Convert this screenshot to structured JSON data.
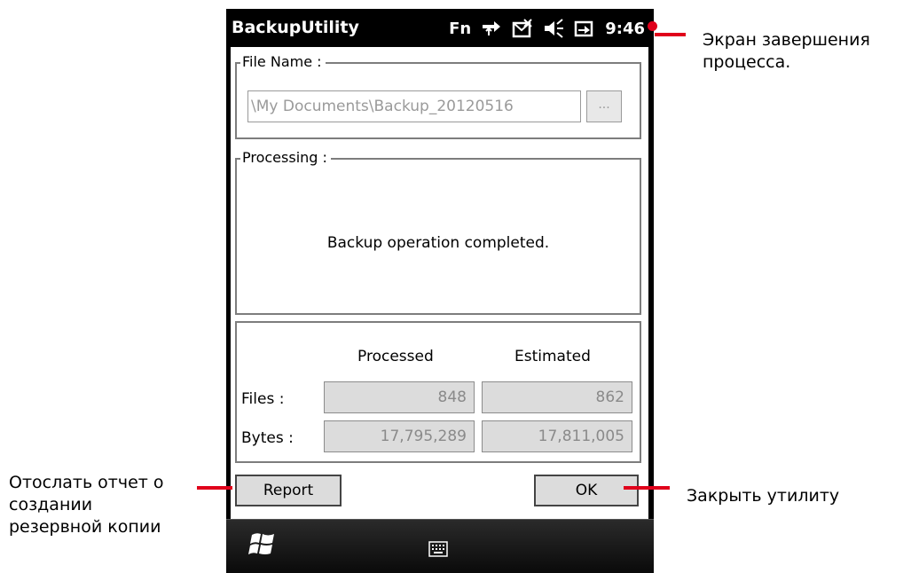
{
  "titlebar": {
    "app_title": "BackupUtility",
    "fn_label": "Fn",
    "time": "9:46"
  },
  "file_name": {
    "legend": "File Name :",
    "path_value": "\\My Documents\\Backup_20120516",
    "browse_label": "..."
  },
  "processing": {
    "legend": "Processing :",
    "message": "Backup operation completed."
  },
  "stats": {
    "col_processed": "Processed",
    "col_estimated": "Estimated",
    "files_label": "Files :",
    "bytes_label": "Bytes :",
    "files_processed": "848",
    "files_estimated": "862",
    "bytes_processed": "17,795,289",
    "bytes_estimated": "17,811,005"
  },
  "buttons": {
    "report": "Report",
    "ok": "OK"
  },
  "annotations": {
    "top_right_line1": "Экран завершения",
    "top_right_line2": "процесса.",
    "left_line1": "Отослать отчет о",
    "left_line2": "создании",
    "left_line3": "резервной копии",
    "right": "Закрыть утилиту"
  },
  "icons": {
    "status": [
      "network-arrows-icon",
      "message-icon",
      "volume-icon",
      "battery-charging-icon"
    ],
    "taskbar": [
      "windows-start-icon",
      "keyboard-icon"
    ]
  },
  "colors": {
    "callout_red": "#e0001b",
    "title_bar": "#000000",
    "field_gray": "#dcdcdc"
  }
}
